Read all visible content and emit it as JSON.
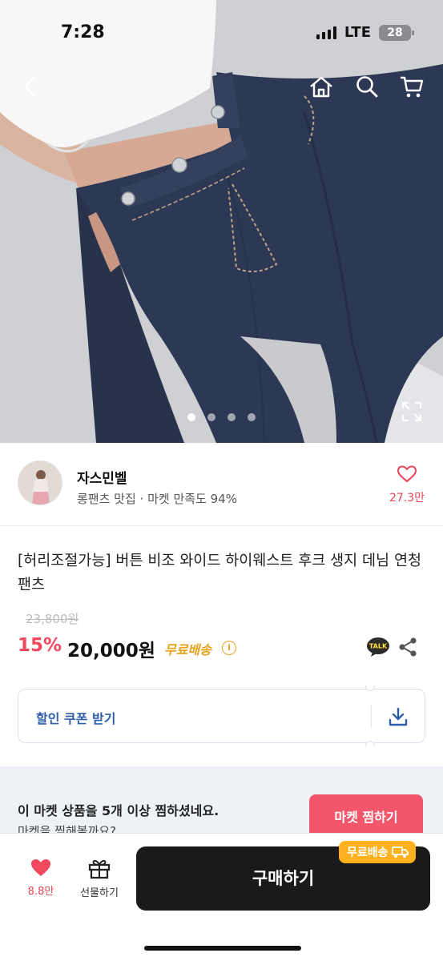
{
  "status_bar": {
    "time": "7:28",
    "network": "LTE",
    "battery": "28"
  },
  "hero": {
    "nav_icons": [
      "back-icon",
      "home-icon",
      "search-icon",
      "cart-icon"
    ],
    "slide_count": 4,
    "active_slide": 1
  },
  "seller": {
    "name": "자스민벨",
    "subtitle": "롱팬츠 맛집 · 마켓 만족도 94%",
    "like_count": "27.3만"
  },
  "product": {
    "title": "[허리조절가능] 버튼 비조 와이드 하이웨스트 후크 생지 데님 연청 팬츠",
    "original_price": "23,800원",
    "discount": "15%",
    "price": "20,000원",
    "shipping": "무료배송",
    "info_icon": "i"
  },
  "coupon": {
    "label": "할인 쿠폰 받기"
  },
  "banner": {
    "line1": "이 마켓 상품을 5개 이상 찜하셨네요.",
    "line2": "마켓을 찜해볼까요?",
    "button": "마켓 찜하기"
  },
  "bottom_bar": {
    "wish_count": "8.8만",
    "gift_label": "선물하기",
    "buy_label": "구매하기",
    "badge": "무료배송"
  },
  "colors": {
    "accent": "#f0485f",
    "free_ship": "#e8a21a",
    "coupon_text": "#2f5fa8",
    "buy": "#1a1a1a",
    "badge": "#ffb11f"
  }
}
